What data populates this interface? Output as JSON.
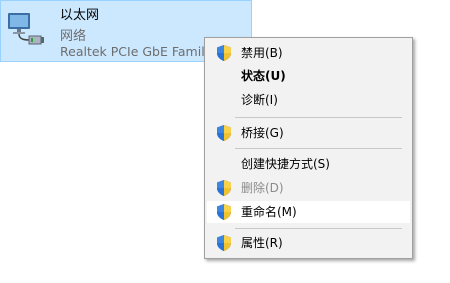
{
  "adapter": {
    "name": "以太网",
    "status": "网络",
    "device": "Realtek PCIe GbE Family"
  },
  "menu": {
    "items": [
      {
        "label": "禁用(B)",
        "icon": "uac-shield-icon",
        "disabled": false,
        "bold": false
      },
      {
        "label": "状态(U)",
        "icon": null,
        "disabled": false,
        "bold": true
      },
      {
        "label": "诊断(I)",
        "icon": null,
        "disabled": false,
        "bold": false
      },
      {
        "label": "桥接(G)",
        "icon": "uac-shield-icon",
        "disabled": false,
        "bold": false
      },
      {
        "label": "创建快捷方式(S)",
        "icon": null,
        "disabled": false,
        "bold": false
      },
      {
        "label": "删除(D)",
        "icon": "uac-shield-icon",
        "disabled": true,
        "bold": false
      },
      {
        "label": "重命名(M)",
        "icon": "uac-shield-icon",
        "disabled": false,
        "bold": false,
        "highlighted": true
      },
      {
        "label": "属性(R)",
        "icon": "uac-shield-icon",
        "disabled": false,
        "bold": false
      }
    ]
  },
  "colors": {
    "selection_bg": "#cce8ff",
    "selection_border": "#99d1ff",
    "menu_bg": "#f2f2f2",
    "menu_hover": "#ffffff",
    "disabled_text": "#8c8c8c"
  }
}
